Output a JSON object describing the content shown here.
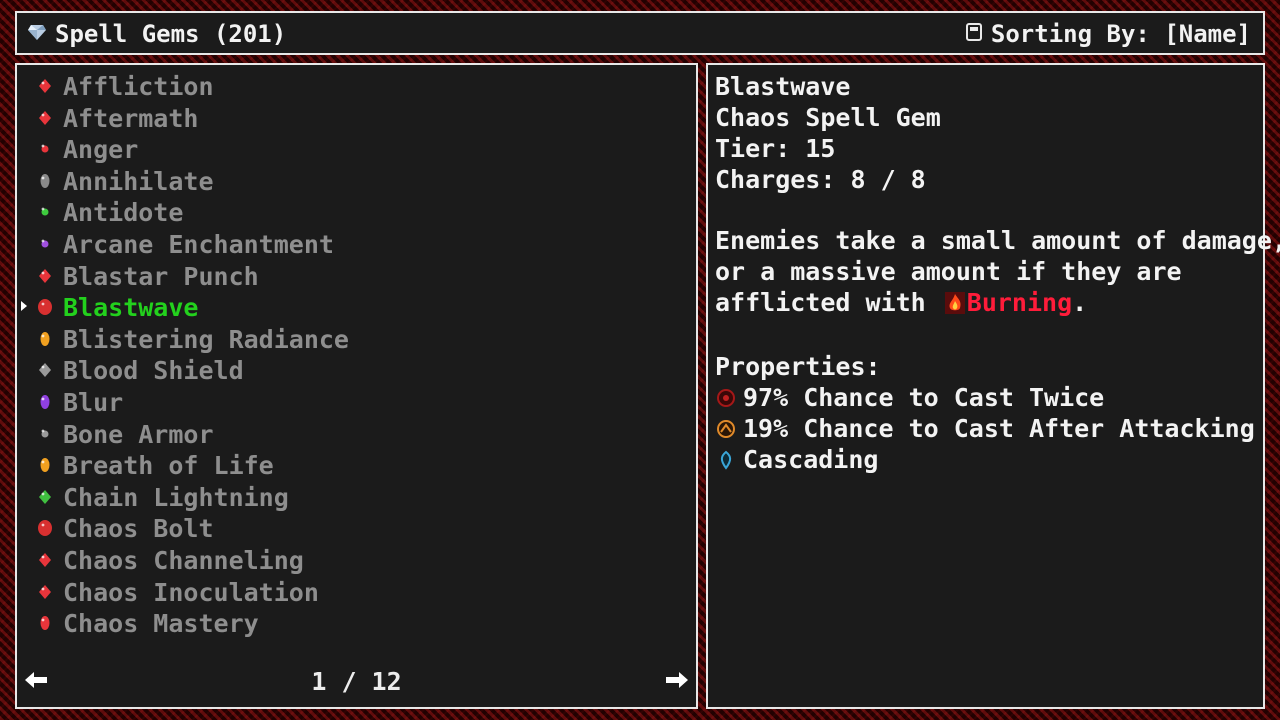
{
  "header": {
    "title": "Spell Gems (201)",
    "sort_label": "Sorting By: [Name]",
    "title_icon": "diamond-icon",
    "sort_icon": "sort-icon"
  },
  "gem_list": {
    "items": [
      {
        "label": "Affliction",
        "color": "#e8353b",
        "icon": "diamond-gem-icon"
      },
      {
        "label": "Aftermath",
        "color": "#e8353b",
        "icon": "diamond-gem-icon"
      },
      {
        "label": "Anger",
        "color": "#e8353b",
        "icon": "dot-gem-icon"
      },
      {
        "label": "Annihilate",
        "color": "#8a8a8a",
        "icon": "oval-gem-icon"
      },
      {
        "label": "Antidote",
        "color": "#3ecb3e",
        "icon": "dot-gem-icon"
      },
      {
        "label": "Arcane Enchantment",
        "color": "#a050e0",
        "icon": "dot-gem-icon"
      },
      {
        "label": "Blastar Punch",
        "color": "#e8353b",
        "icon": "diamond-gem-icon"
      },
      {
        "label": "Blastwave",
        "color": "#d83030",
        "icon": "round-gem-icon",
        "selected": true
      },
      {
        "label": "Blistering Radiance",
        "color": "#f0a020",
        "icon": "oval-gem-icon"
      },
      {
        "label": "Blood Shield",
        "color": "#9a9a9a",
        "icon": "diamond-gem-icon"
      },
      {
        "label": "Blur",
        "color": "#9040e0",
        "icon": "oval-gem-icon"
      },
      {
        "label": "Bone Armor",
        "color": "#9a9a9a",
        "icon": "dot-gem-icon"
      },
      {
        "label": "Breath of Life",
        "color": "#f0a020",
        "icon": "oval-gem-icon"
      },
      {
        "label": "Chain Lightning",
        "color": "#40c040",
        "icon": "diamond-gem-icon"
      },
      {
        "label": "Chaos Bolt",
        "color": "#d83030",
        "icon": "round-gem-icon"
      },
      {
        "label": "Chaos Channeling",
        "color": "#e8353b",
        "icon": "diamond-gem-icon"
      },
      {
        "label": "Chaos Inoculation",
        "color": "#e8353b",
        "icon": "diamond-gem-icon"
      },
      {
        "label": "Chaos Mastery",
        "color": "#e8353b",
        "icon": "oval-gem-icon"
      }
    ]
  },
  "pager": {
    "page_text": "1 / 12",
    "prev_icon": "left-arrow-icon",
    "next_icon": "right-arrow-icon"
  },
  "detail": {
    "name": "Blastwave",
    "type": "Chaos Spell Gem",
    "tier": "Tier: 15",
    "charges": "Charges: 8 / 8",
    "description_line1": "Enemies take a small amount of damage,",
    "description_line2": "or a massive amount if they are",
    "description_line3_prefix": "afflicted with",
    "description_keyword": "Burning",
    "description_suffix": ".",
    "properties_heading": "Properties:",
    "properties": [
      {
        "text": "97% Chance to Cast Twice",
        "icon": "twice-cast-icon",
        "color": "#c02020"
      },
      {
        "text": "19% Chance to Cast After Attacking",
        "icon": "attack-cast-icon",
        "color": "#e08a2a"
      },
      {
        "text": "Cascading",
        "icon": "cascade-icon",
        "color": "#3aa6d8"
      }
    ]
  }
}
